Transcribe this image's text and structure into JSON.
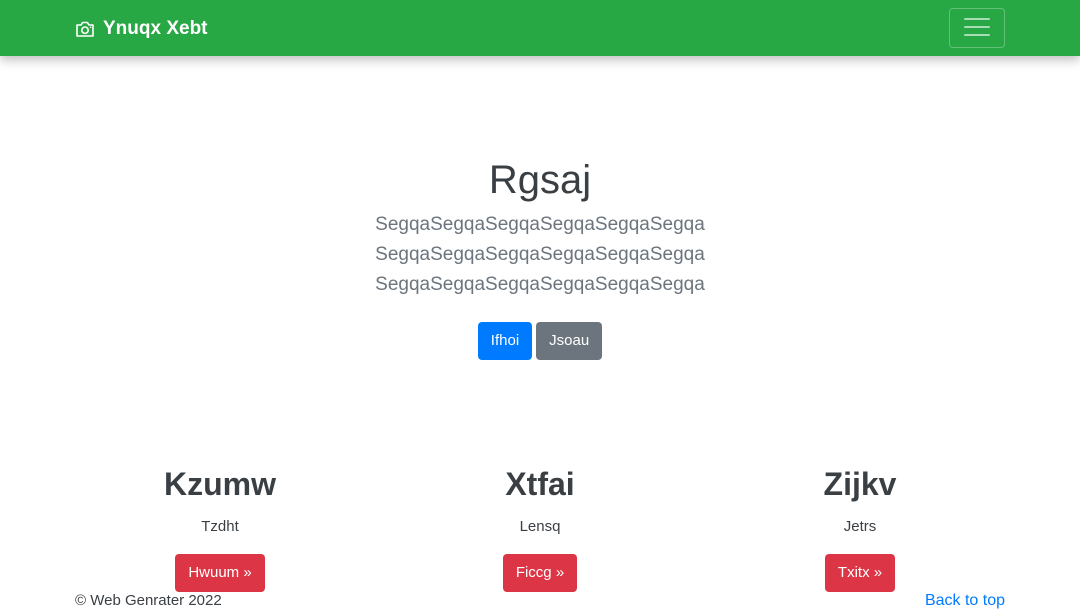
{
  "navbar": {
    "brand": "Ynuqx Xebt",
    "brand_icon": "camera-icon",
    "toggler_icon": "hamburger-menu-icon",
    "background": "#28a745"
  },
  "hero": {
    "title": "Rgsaj",
    "lead_lines": [
      "SegqaSegqaSegqaSegqaSegqaSegqa",
      "SegqaSegqaSegqaSegqaSegqaSegqa",
      "SegqaSegqaSegqaSegqaSegqaSegqa"
    ],
    "primary_button": "Ifhoi",
    "secondary_button": "Jsoau"
  },
  "columns": [
    {
      "heading": "Kzumw",
      "text": "Tzdht",
      "button": "Hwuum »"
    },
    {
      "heading": "Xtfai",
      "text": "Lensq",
      "button": "Ficcg »"
    },
    {
      "heading": "Zijkv",
      "text": "Jetrs",
      "button": "Txitx »"
    }
  ],
  "footer": {
    "copyright": "© Web Genrater 2022",
    "back_to_top": "Back to top"
  },
  "colors": {
    "primary": "#007bff",
    "secondary": "#6c757d",
    "danger": "#dc3545",
    "success": "#28a745"
  }
}
